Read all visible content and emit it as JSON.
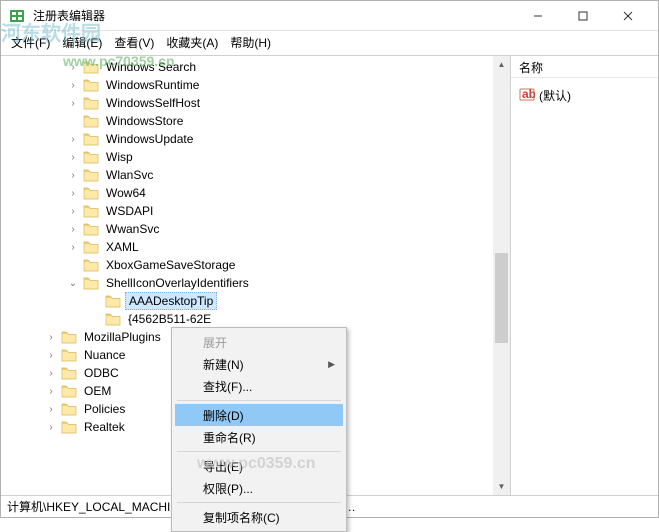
{
  "window": {
    "title": "注册表编辑器"
  },
  "menu": {
    "file": "文件(F)",
    "edit": "编辑(E)",
    "view": "查看(V)",
    "favorites": "收藏夹(A)",
    "help": "帮助(H)"
  },
  "watermarks": {
    "wm1": "河东软件园",
    "wm2": "www.pc70359.cn",
    "wm3": "www.pc0359.cn"
  },
  "list": {
    "header_name": "名称",
    "rows": [
      {
        "name": "(默认)"
      }
    ]
  },
  "tree": {
    "items": [
      {
        "label": "Windows Search",
        "exp": ">",
        "depth": 0
      },
      {
        "label": "WindowsRuntime",
        "exp": ">",
        "depth": 0
      },
      {
        "label": "WindowsSelfHost",
        "exp": ">",
        "depth": 0
      },
      {
        "label": "WindowsStore",
        "exp": "",
        "depth": 0
      },
      {
        "label": "WindowsUpdate",
        "exp": ">",
        "depth": 0
      },
      {
        "label": "Wisp",
        "exp": ">",
        "depth": 0
      },
      {
        "label": "WlanSvc",
        "exp": ">",
        "depth": 0
      },
      {
        "label": "Wow64",
        "exp": ">",
        "depth": 0
      },
      {
        "label": "WSDAPI",
        "exp": ">",
        "depth": 0
      },
      {
        "label": "WwanSvc",
        "exp": ">",
        "depth": 0
      },
      {
        "label": "XAML",
        "exp": ">",
        "depth": 0
      },
      {
        "label": "XboxGameSaveStorage",
        "exp": "",
        "depth": 0
      },
      {
        "label": "ShellIconOverlayIdentifiers",
        "exp": "v",
        "depth": 0
      },
      {
        "label": "AAADesktopTip",
        "exp": "",
        "depth": 1,
        "selected": true
      },
      {
        "label": "{4562B511-62E",
        "exp": "",
        "depth": 1
      },
      {
        "label": "MozillaPlugins",
        "exp": ">",
        "depth": -1
      },
      {
        "label": "Nuance",
        "exp": ">",
        "depth": -1
      },
      {
        "label": "ODBC",
        "exp": ">",
        "depth": -1
      },
      {
        "label": "OEM",
        "exp": ">",
        "depth": -1
      },
      {
        "label": "Policies",
        "exp": ">",
        "depth": -1
      },
      {
        "label": "Realtek",
        "exp": ">",
        "depth": -1
      }
    ]
  },
  "context_menu": {
    "expand": "展开",
    "new": "新建(N)",
    "find": "查找(F)...",
    "delete": "删除(D)",
    "rename": "重命名(R)",
    "export": "导出(E)",
    "permissions": "权限(P)...",
    "copykeyname": "复制项名称(C)"
  },
  "statusbar": {
    "path": "计算机\\HKEY_LOCAL_MACHINE\\SOFTW…                                            layIdentifiers\\AAA…"
  }
}
